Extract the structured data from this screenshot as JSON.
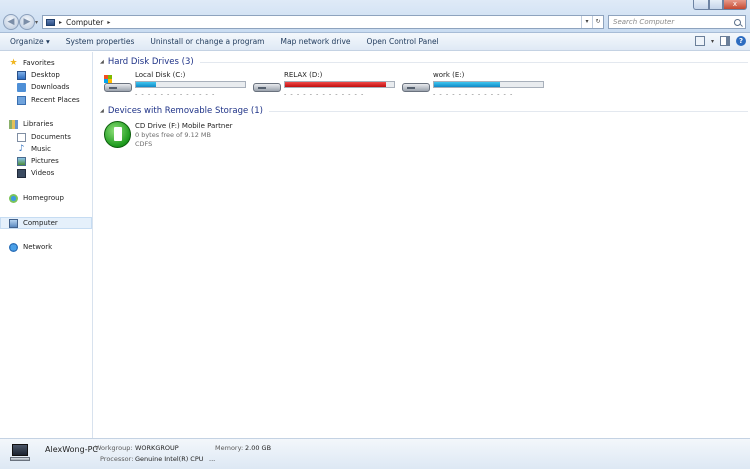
{
  "titlebar": {
    "address_sep": "▸",
    "location": "Computer",
    "search_placeholder": "Search Computer",
    "close_glyph": "x"
  },
  "toolbar": {
    "commands": [
      "Organize ▾",
      "System properties",
      "Uninstall or change a program",
      "Map network drive",
      "Open Control Panel"
    ],
    "view_dropdown": "▾"
  },
  "nav": {
    "favorites": "Favorites",
    "desktop": "Desktop",
    "downloads": "Downloads",
    "recent_places": "Recent Places",
    "libraries": "Libraries",
    "documents": "Documents",
    "music": "Music",
    "pictures": "Pictures",
    "videos": "Videos",
    "homegroup": "Homegroup",
    "computer": "Computer",
    "network": "Network"
  },
  "groups": {
    "hard_disks": "Hard Disk Drives (3)",
    "removable": "Devices with Removable Storage (1)"
  },
  "drives": [
    {
      "name": "Local Disk (C:)",
      "used_fraction": 0.18,
      "bar_color": "#1a9ad6",
      "sub": "- - - - - - - - - - - - -"
    },
    {
      "name": "RELAX (D:)",
      "used_fraction": 0.93,
      "bar_color": "#d81e1e",
      "sub": "- - - - - - - - - - - - -"
    },
    {
      "name": "work (E:)",
      "used_fraction": 0.61,
      "bar_color": "#1a9ad6",
      "sub": "- - - - - - - - - - - - -"
    }
  ],
  "removable": {
    "name": "CD Drive (F:) Mobile Partner",
    "free": "0 bytes free of 9.12 MB",
    "fs": "CDFS"
  },
  "details": {
    "pc_name": "AlexWong-PC",
    "workgroup_label": "Workgroup:",
    "workgroup_value": "WORKGROUP",
    "memory_label": "Memory:",
    "memory_value": "2.00 GB",
    "processor_label": "Processor:",
    "processor_value": "Genuine Intel(R) CPU",
    "more": "..."
  }
}
